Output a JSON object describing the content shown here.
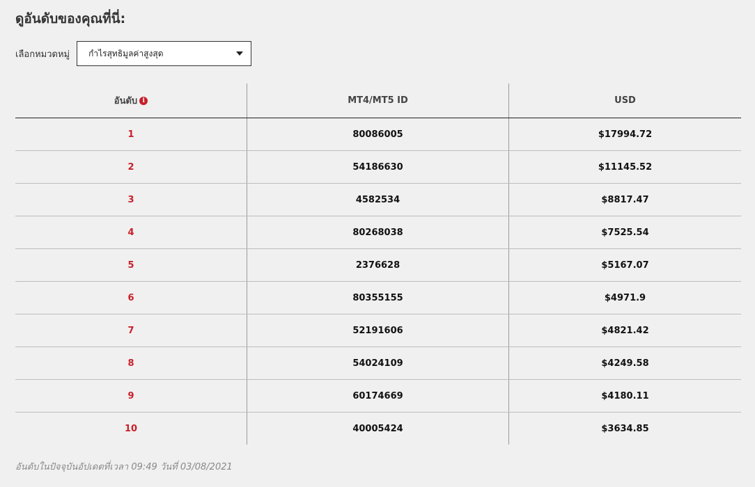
{
  "page": {
    "title": "ดูอันดับของคุณที่นี่:"
  },
  "filter": {
    "label": "เลือกหมวดหมู่",
    "selected": "กำไรสุทธิมูลค่าสูงสุด"
  },
  "table": {
    "columns": [
      "อันดับ",
      "MT4/MT5 ID",
      "USD"
    ],
    "info_icon": "info-icon",
    "rows": [
      {
        "rank": "1",
        "id": "80086005",
        "usd": "$17994.72"
      },
      {
        "rank": "2",
        "id": "54186630",
        "usd": "$11145.52"
      },
      {
        "rank": "3",
        "id": "4582534",
        "usd": "$8817.47"
      },
      {
        "rank": "4",
        "id": "80268038",
        "usd": "$7525.54"
      },
      {
        "rank": "5",
        "id": "2376628",
        "usd": "$5167.07"
      },
      {
        "rank": "6",
        "id": "80355155",
        "usd": "$4971.9"
      },
      {
        "rank": "7",
        "id": "52191606",
        "usd": "$4821.42"
      },
      {
        "rank": "8",
        "id": "54024109",
        "usd": "$4249.58"
      },
      {
        "rank": "9",
        "id": "60174669",
        "usd": "$4180.11"
      },
      {
        "rank": "10",
        "id": "40005424",
        "usd": "$3634.85"
      }
    ]
  },
  "footer": {
    "note": "อันดับในปัจจุบันอัปเดตที่เวลา 09:49 วันที่ 03/08/2021"
  },
  "colors": {
    "background": "#f0f0f0",
    "accent_red": "#c8202a"
  }
}
